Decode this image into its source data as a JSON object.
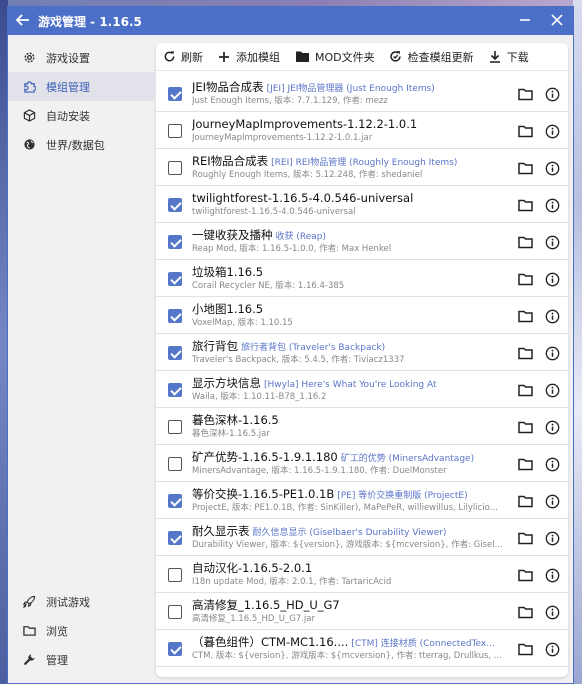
{
  "window": {
    "title": "游戏管理 - 1.16.5"
  },
  "sidebar": {
    "items": [
      {
        "label": "游戏设置",
        "icon": "gear-icon"
      },
      {
        "label": "模组管理",
        "icon": "puzzle-icon"
      },
      {
        "label": "自动安装",
        "icon": "cube-icon"
      },
      {
        "label": "世界/数据包",
        "icon": "globe-icon"
      }
    ],
    "bottom": [
      {
        "label": "测试游戏",
        "icon": "rocket-icon"
      },
      {
        "label": "浏览",
        "icon": "folder-icon"
      },
      {
        "label": "管理",
        "icon": "wrench-icon"
      }
    ]
  },
  "toolbar": {
    "refresh": "刷新",
    "add_mod": "添加模组",
    "mod_folder": "MOD文件夹",
    "check_updates": "检查模组更新",
    "download": "下载"
  },
  "mods": [
    {
      "checked": true,
      "name": "JEI物品合成表",
      "alias": "[JEI] JEI物品管理器 (Just Enough Items)",
      "detail": "Just Enough Items, 版本: 7.7.1.129, 作者: mezz"
    },
    {
      "checked": false,
      "name": "JourneyMapImprovements-1.12.2-1.0.1",
      "alias": "",
      "detail": "JourneyMapImprovements-1.12.2-1.0.1.jar"
    },
    {
      "checked": false,
      "name": "REI物品合成表",
      "alias": "[REI] REI物品管理 (Roughly Enough Items)",
      "detail": "Roughly Enough Items, 版本: 5.12.248, 作者: shedaniel"
    },
    {
      "checked": true,
      "name": "twilightforest-1.16.5-4.0.546-universal",
      "alias": "",
      "detail": "twilightforest-1.16.5-4.0.546-universal"
    },
    {
      "checked": true,
      "name": "一键收获及播种",
      "alias": "收获 (Reap)",
      "detail": "Reap Mod, 版本: 1.16.5-1.0.0, 作者: Max Henkel"
    },
    {
      "checked": true,
      "name": "垃圾箱1.16.5",
      "alias": "",
      "detail": "Corail Recycler NE, 版本: 1.16.4-385"
    },
    {
      "checked": true,
      "name": "小地图1.16.5",
      "alias": "",
      "detail": "VoxelMap, 版本: 1.10.15"
    },
    {
      "checked": true,
      "name": "旅行背包",
      "alias": "旅行者背包 (Traveler's Backpack)",
      "detail": "Traveler's Backpack, 版本: 5.4.5, 作者: Tiviacz1337"
    },
    {
      "checked": true,
      "name": "显示方块信息",
      "alias": "[Hwyla] Here's What You're Looking At",
      "detail": "Waila, 版本: 1.10.11-B78_1.16.2"
    },
    {
      "checked": false,
      "name": "暮色深林-1.16.5",
      "alias": "",
      "detail": "暮色深林-1.16.5.jar"
    },
    {
      "checked": false,
      "name": "矿产优势-1.16.5-1.9.1.180",
      "alias": "矿工的优势 (MinersAdvantage)",
      "detail": "MinersAdvantage, 版本: 1.16.5-1.9.1.180, 作者: DuelMonster"
    },
    {
      "checked": true,
      "name": "等价交换-1.16.5-PE1.0.1B",
      "alias": "[PE] 等价交换重制版 (ProjectE)",
      "detail": "ProjectE, 版本: PE1.0.1B, 作者: SinKiller), MaPePeR, williewillus, Lilylicio..."
    },
    {
      "checked": true,
      "name": "耐久显示表",
      "alias": "耐久信息显示 (Giselbaer's Durability Viewer)",
      "detail": "Durability Viewer, 版本: ${version}, 游戏版本: ${mcversion}, 作者: Gisel..."
    },
    {
      "checked": false,
      "name": "自动汉化-1.16.5-2.0.1",
      "alias": "",
      "detail": "I18n update Mod, 版本: 2.0.1, 作者: TartaricAcid"
    },
    {
      "checked": false,
      "name": "高清修复_1.16.5_HD_U_G7",
      "alias": "",
      "detail": "高清修复_1.16.5_HD_U_G7.jar"
    },
    {
      "checked": true,
      "name": "（暮色组件）CTM-MC1.16....",
      "alias": "[CTM] 连接材质 (ConnectedTex...",
      "detail": "CTM, 版本: ${version}, 游戏版本: ${mcversion}, 作者: tterrag, Drullkus, ..."
    }
  ],
  "colors": {
    "accent": "#4c6fc7",
    "checkbox": "#5577c9",
    "alias_text": "#5a74c9"
  }
}
